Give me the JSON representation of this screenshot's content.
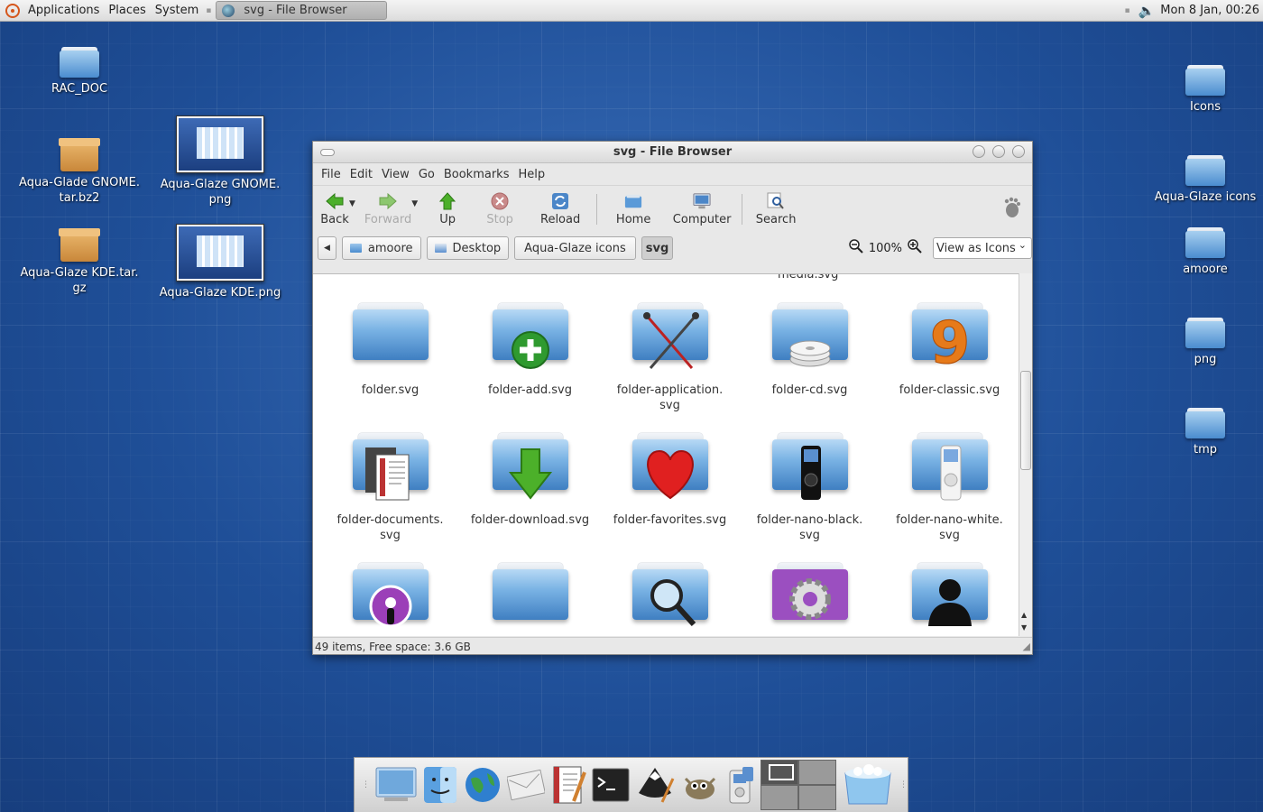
{
  "panel": {
    "menus": [
      "Applications",
      "Places",
      "System"
    ],
    "task_title": "svg - File Browser",
    "clock": "Mon  8 Jan, 00:26"
  },
  "desktop_left": [
    {
      "label": "RAC_DOC",
      "kind": "folder"
    },
    {
      "label": "Aqua-Glade GNOME.\ntar.bz2",
      "kind": "archive"
    },
    {
      "label": "Aqua-Glaze KDE.tar.\ngz",
      "kind": "archive"
    },
    {
      "label": "Aqua-Glaze GNOME.\npng",
      "kind": "image"
    },
    {
      "label": "Aqua-Glaze KDE.png",
      "kind": "image"
    }
  ],
  "desktop_right": [
    {
      "label": "Icons"
    },
    {
      "label": "Aqua-Glaze icons"
    },
    {
      "label": "amoore"
    },
    {
      "label": "png"
    },
    {
      "label": "tmp"
    }
  ],
  "window": {
    "title": "svg - File Browser",
    "menu": [
      "File",
      "Edit",
      "View",
      "Go",
      "Bookmarks",
      "Help"
    ],
    "toolbar": {
      "back": "Back",
      "forward": "Forward",
      "up": "Up",
      "stop": "Stop",
      "reload": "Reload",
      "home": "Home",
      "computer": "Computer",
      "search": "Search"
    },
    "path": [
      "amoore",
      "Desktop",
      "Aqua-Glaze icons",
      "svg"
    ],
    "zoom": "100%",
    "view_mode": "View as Icons",
    "partial_item": "media.svg",
    "files": [
      {
        "name": "folder.svg",
        "emblem": "none"
      },
      {
        "name": "folder-add.svg",
        "emblem": "add"
      },
      {
        "name": "folder-application.\nsvg",
        "emblem": "brushes"
      },
      {
        "name": "folder-cd.svg",
        "emblem": "cd"
      },
      {
        "name": "folder-classic.svg",
        "emblem": "nine"
      },
      {
        "name": "folder-documents.\nsvg",
        "emblem": "documents"
      },
      {
        "name": "folder-download.svg",
        "emblem": "download"
      },
      {
        "name": "folder-favorites.svg",
        "emblem": "heart"
      },
      {
        "name": "folder-nano-black.\nsvg",
        "emblem": "nano-black"
      },
      {
        "name": "folder-nano-white.\nsvg",
        "emblem": "nano-white"
      },
      {
        "name": "",
        "emblem": "podcast"
      },
      {
        "name": "",
        "emblem": "none"
      },
      {
        "name": "",
        "emblem": "magnifier"
      },
      {
        "name": "",
        "emblem": "gear"
      },
      {
        "name": "",
        "emblem": "person"
      }
    ],
    "status": "49 items, Free space: 3.6 GB"
  },
  "dock": [
    "desktop",
    "finder",
    "globe",
    "mail",
    "text-editor",
    "terminal",
    "inkscape",
    "gimp",
    "ipod",
    "pager",
    "trash"
  ]
}
